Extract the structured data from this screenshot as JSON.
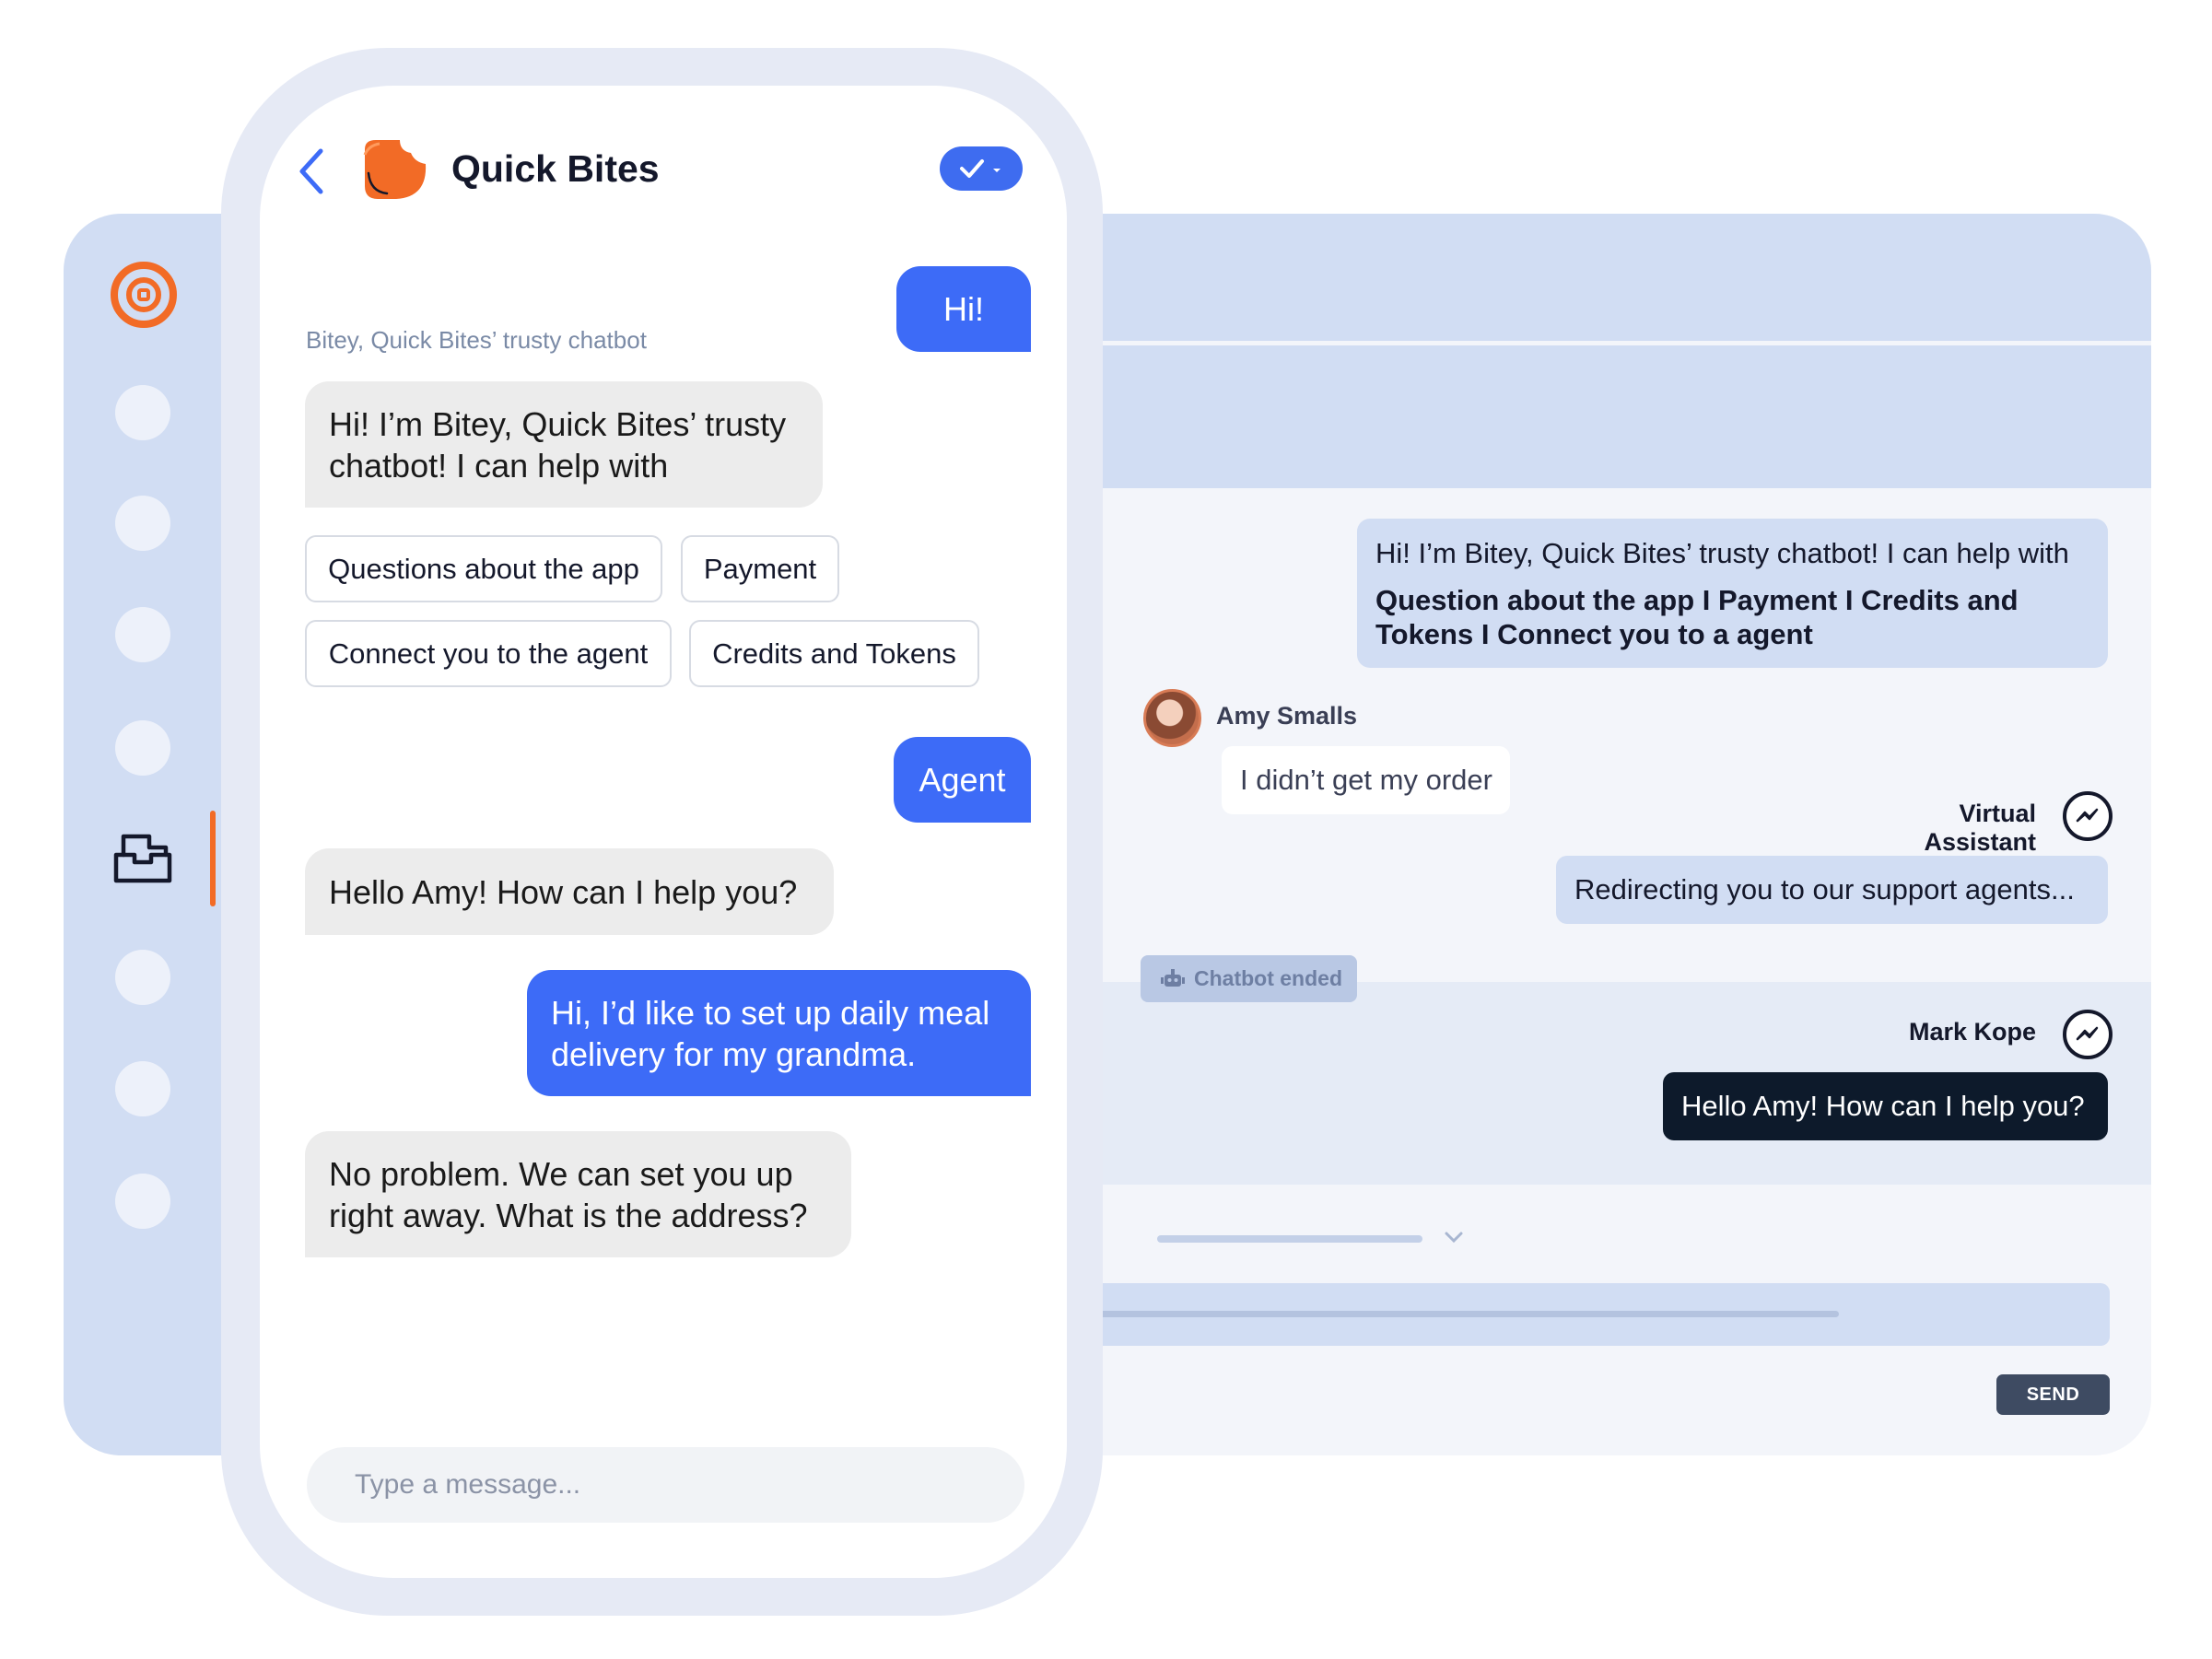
{
  "brand": {
    "accent": "#f26b26",
    "primary_blue": "#3d6bf7"
  },
  "phone": {
    "header": {
      "title": "Quick Bites",
      "back_icon": "chevron-left-icon",
      "status_icon": "check-icon"
    },
    "bot_caption": "Bitey, Quick Bites’ trusty chatbot",
    "messages": {
      "hi": "Hi!",
      "bot_intro": "Hi! I’m Bitey, Quick Bites’ trusty chatbot! I can help with",
      "agent": "Agent",
      "hello": "Hello Amy! How can I help you?",
      "meal": "Hi, I’d like to set up daily meal delivery for my grandma.",
      "address": "No problem. We can set you up right away. What is the address?"
    },
    "quick_replies": [
      "Questions about the app",
      "Payment",
      "Connect you to the agent",
      "Credits and Tokens"
    ],
    "input_placeholder": "Type a message..."
  },
  "desk": {
    "bot_card": {
      "line1": "Hi! I’m Bitey, Quick Bites’ trusty chatbot! I can help with",
      "options": "Question about the app   I   Payment   I  Credits and Tokens I Connect you to a agent"
    },
    "customer": {
      "name": "Amy Smalls",
      "message": "I didn’t get my order"
    },
    "virtual_assistant": {
      "name": "Virtual Assistant",
      "message": "Redirecting you to our support agents..."
    },
    "chatbot_ended": "Chatbot ended",
    "agent": {
      "name": "Mark Kope",
      "message": "Hello Amy! How can I help you?"
    },
    "send_label": "SEND"
  }
}
